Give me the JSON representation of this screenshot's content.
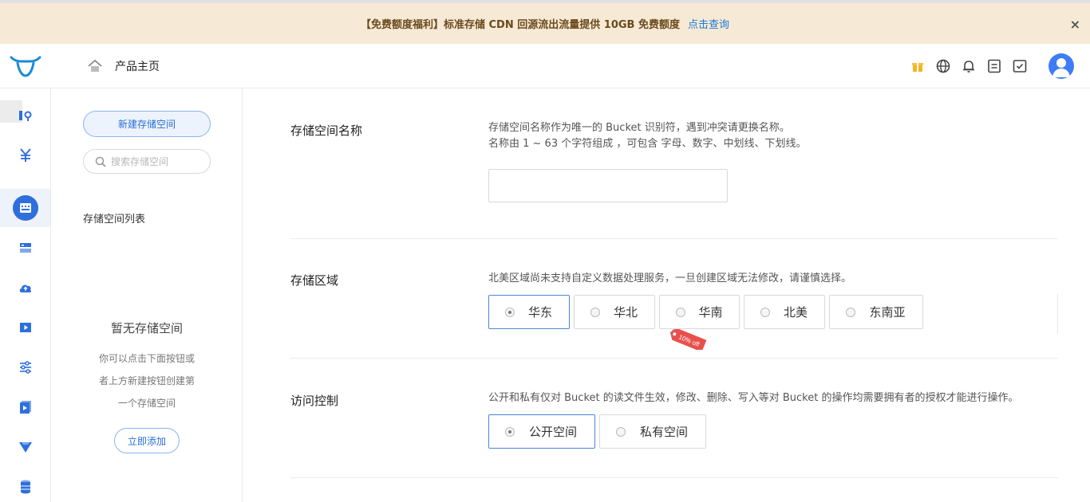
{
  "banner": {
    "text": "【免费额度福利】标准存储 CDN 回源流出流量提供 10GB 免费额度",
    "link": "点击查询",
    "close": "×"
  },
  "header": {
    "home_label": "产品主页",
    "icons": [
      "gift-icon",
      "globe-icon",
      "bell-icon",
      "document-icon",
      "task-check-icon"
    ],
    "accent": "#3e7cf7"
  },
  "rail": {
    "icons": [
      "image-location-icon",
      "yen-icon",
      "storage-bucket-icon",
      "server-list-icon",
      "cloud-upload-icon",
      "video-icon",
      "sliders-icon",
      "media-play-icon",
      "funnel-icon",
      "database-icon"
    ]
  },
  "sidebar": {
    "new_button": "新建存储空间",
    "search_placeholder": "搜索存储空间",
    "list_title": "存储空间列表",
    "empty_title": "暂无存储空间",
    "empty_desc": [
      "你可以点击下面按钮或",
      "者上方新建按钮创建第",
      "一个存储空间"
    ],
    "add_button": "立即添加"
  },
  "form": {
    "name": {
      "label": "存储空间名称",
      "desc1": "存储空间名称作为唯一的 Bucket 识别符，遇到冲突请更换名称。",
      "desc2": "名称由 1 ~ 63 个字符组成 ，可包含 字母、数字、中划线、下划线。",
      "value": ""
    },
    "region": {
      "label": "存储区域",
      "desc": "北美区域尚未支持自定义数据处理服务，一旦创建区域无法修改，请谨慎选择。",
      "options": [
        "华东",
        "华北",
        "华南",
        "北美",
        "东南亚"
      ],
      "selected": "华东",
      "discount_tag": "10% off"
    },
    "access": {
      "label": "访问控制",
      "desc": "公开和私有仅对 Bucket 的读文件生效，修改、删除、写入等对 Bucket 的操作均需要拥有者的授权才能进行操作。",
      "options": [
        "公开空间",
        "私有空间"
      ],
      "selected": "公开空间"
    }
  }
}
